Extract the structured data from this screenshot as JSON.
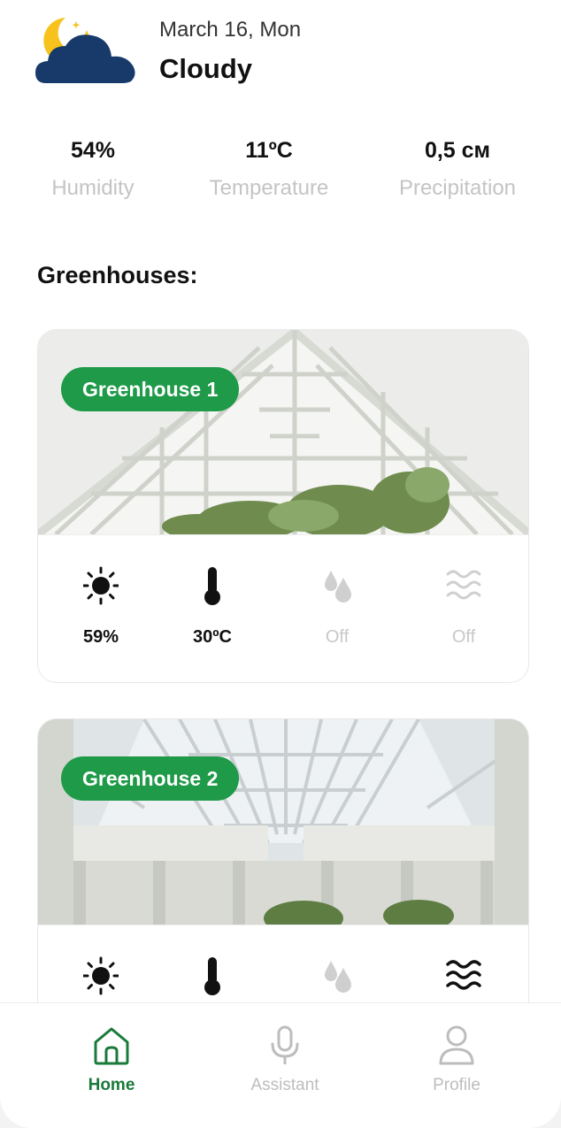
{
  "header": {
    "date": "March 16, Mon",
    "condition": "Cloudy",
    "weather_icon": "night-cloudy-icon"
  },
  "stats": [
    {
      "value": "54%",
      "label": "Humidity"
    },
    {
      "value": "11ºC",
      "label": "Temperature"
    },
    {
      "value": "0,5 см",
      "label": "Precipitation"
    }
  ],
  "section_title": "Greenhouses:",
  "greenhouses": [
    {
      "name": "Greenhouse 1",
      "metrics": [
        {
          "icon": "sun-icon",
          "value": "59%",
          "active": true
        },
        {
          "icon": "thermometer-icon",
          "value": "30ºC",
          "active": true
        },
        {
          "icon": "water-drops-icon",
          "value": "Off",
          "active": false
        },
        {
          "icon": "wind-waves-icon",
          "value": "Off",
          "active": false
        }
      ]
    },
    {
      "name": "Greenhouse 2",
      "metrics": [
        {
          "icon": "sun-icon",
          "active": true
        },
        {
          "icon": "thermometer-icon",
          "active": true
        },
        {
          "icon": "water-drops-icon",
          "active": false
        },
        {
          "icon": "wind-waves-icon",
          "active": true
        }
      ]
    }
  ],
  "nav": {
    "home": "Home",
    "assistant": "Assistant",
    "profile": "Profile"
  },
  "colors": {
    "accent_green": "#1e9a48",
    "nav_active": "#1a7a3b",
    "cloud_navy": "#173a6b",
    "moon_yellow": "#f6c21b",
    "muted": "#c4c4c4"
  }
}
